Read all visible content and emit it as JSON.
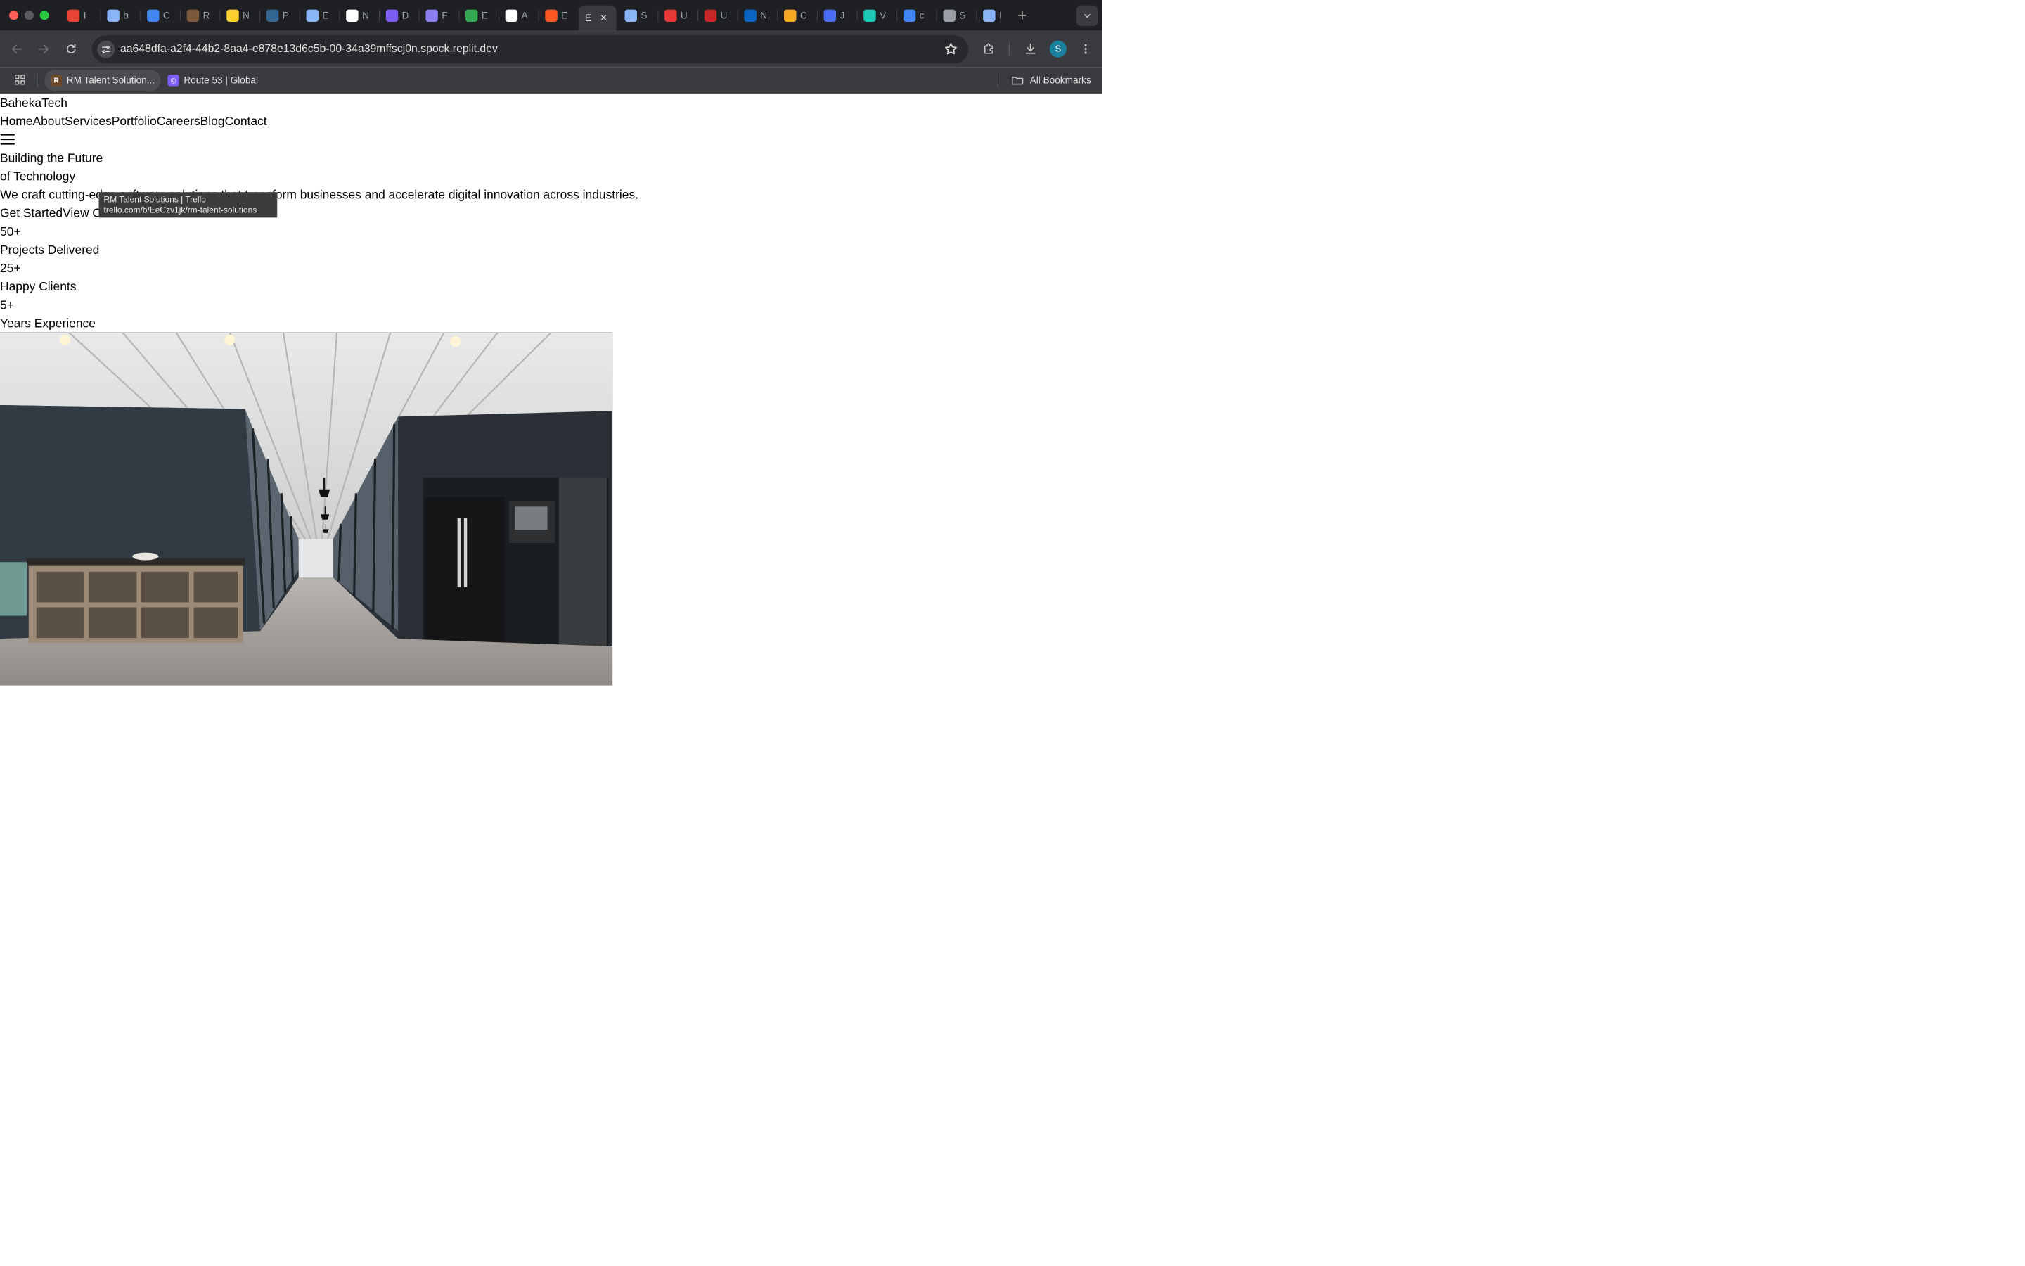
{
  "browser": {
    "tabs": [
      {
        "icon": "gmail-icon",
        "letter": "I",
        "color": "#ea4335"
      },
      {
        "icon": "globe-icon",
        "letter": "b",
        "color": "#8ab4f8"
      },
      {
        "icon": "calendar-icon",
        "letter": "C",
        "color": "#4285f4"
      },
      {
        "icon": "trello-board-icon",
        "letter": "R",
        "color": "#7a5a3a"
      },
      {
        "icon": "miro-icon",
        "letter": "N",
        "color": "#ffd02f"
      },
      {
        "icon": "postgres-icon",
        "letter": "P",
        "color": "#336791"
      },
      {
        "icon": "globe-icon",
        "letter": "E",
        "color": "#8ab4f8"
      },
      {
        "icon": "hook-icon",
        "letter": "N",
        "color": "#ffffff"
      },
      {
        "icon": "cube-purple-icon",
        "letter": "D",
        "color": "#7b5cf5"
      },
      {
        "icon": "cube-icon",
        "letter": "F",
        "color": "#8a7df0"
      },
      {
        "icon": "sheet-icon",
        "letter": "E",
        "color": "#34a853"
      },
      {
        "icon": "openai-icon",
        "letter": "A",
        "color": "#ffffff"
      },
      {
        "icon": "grid-orange-icon",
        "letter": "E",
        "color": "#ff5722"
      },
      {
        "icon": "",
        "letter": "E",
        "color": "",
        "active": true
      },
      {
        "icon": "globe-icon",
        "letter": "S",
        "color": "#8ab4f8"
      },
      {
        "icon": "red-app-icon",
        "letter": "U",
        "color": "#e53935"
      },
      {
        "icon": "eye-icon",
        "letter": "U",
        "color": "#c62828"
      },
      {
        "icon": "linkedin-icon",
        "letter": "N",
        "color": "#0a66c2"
      },
      {
        "icon": "w-icon",
        "letter": "C",
        "color": "#f5a623"
      },
      {
        "icon": "grid-blue-icon",
        "letter": "J",
        "color": "#4a6cf7"
      },
      {
        "icon": "swirl-icon",
        "letter": "V",
        "color": "#1fc7b6"
      },
      {
        "icon": "google-icon",
        "letter": "c",
        "color": "#4285f4"
      },
      {
        "icon": "gear-icon",
        "letter": "S",
        "color": "#9aa0a6"
      },
      {
        "icon": "globe-icon",
        "letter": "I",
        "color": "#8ab4f8"
      }
    ],
    "url": "aa648dfa-a2f4-44b2-8aa4-e878e13d6c5b-00-34a39mffscj0n.spock.replit.dev",
    "avatar_letter": "S",
    "bookmarks": [
      {
        "label": "RM Talent Solution...",
        "icon": "trello-board-icon"
      },
      {
        "label": "Route 53 | Global",
        "icon": "route53-icon"
      }
    ],
    "all_bookmarks": "All Bookmarks",
    "tooltip": {
      "title": "RM Talent Solutions | Trello",
      "url": "trello.com/b/EeCzv1jk/rm-talent-solutions"
    }
  },
  "site": {
    "brand": "BahekaTech",
    "nav": [
      "Home",
      "About",
      "Services",
      "Portfolio",
      "Careers",
      "Blog",
      "Contact"
    ],
    "hero": {
      "title_line1": "Building the Future",
      "title_line2": "of Technology",
      "subtitle": "We craft cutting-edge software solutions that transform businesses and accelerate digital innovation across industries.",
      "cta_primary": "Get Started",
      "cta_secondary": "View Our Work"
    },
    "stats": [
      {
        "value": "50+",
        "label": "Projects Delivered"
      },
      {
        "value": "25+",
        "label": "Happy Clients"
      },
      {
        "value": "5+",
        "label": "Years Experience"
      }
    ]
  }
}
